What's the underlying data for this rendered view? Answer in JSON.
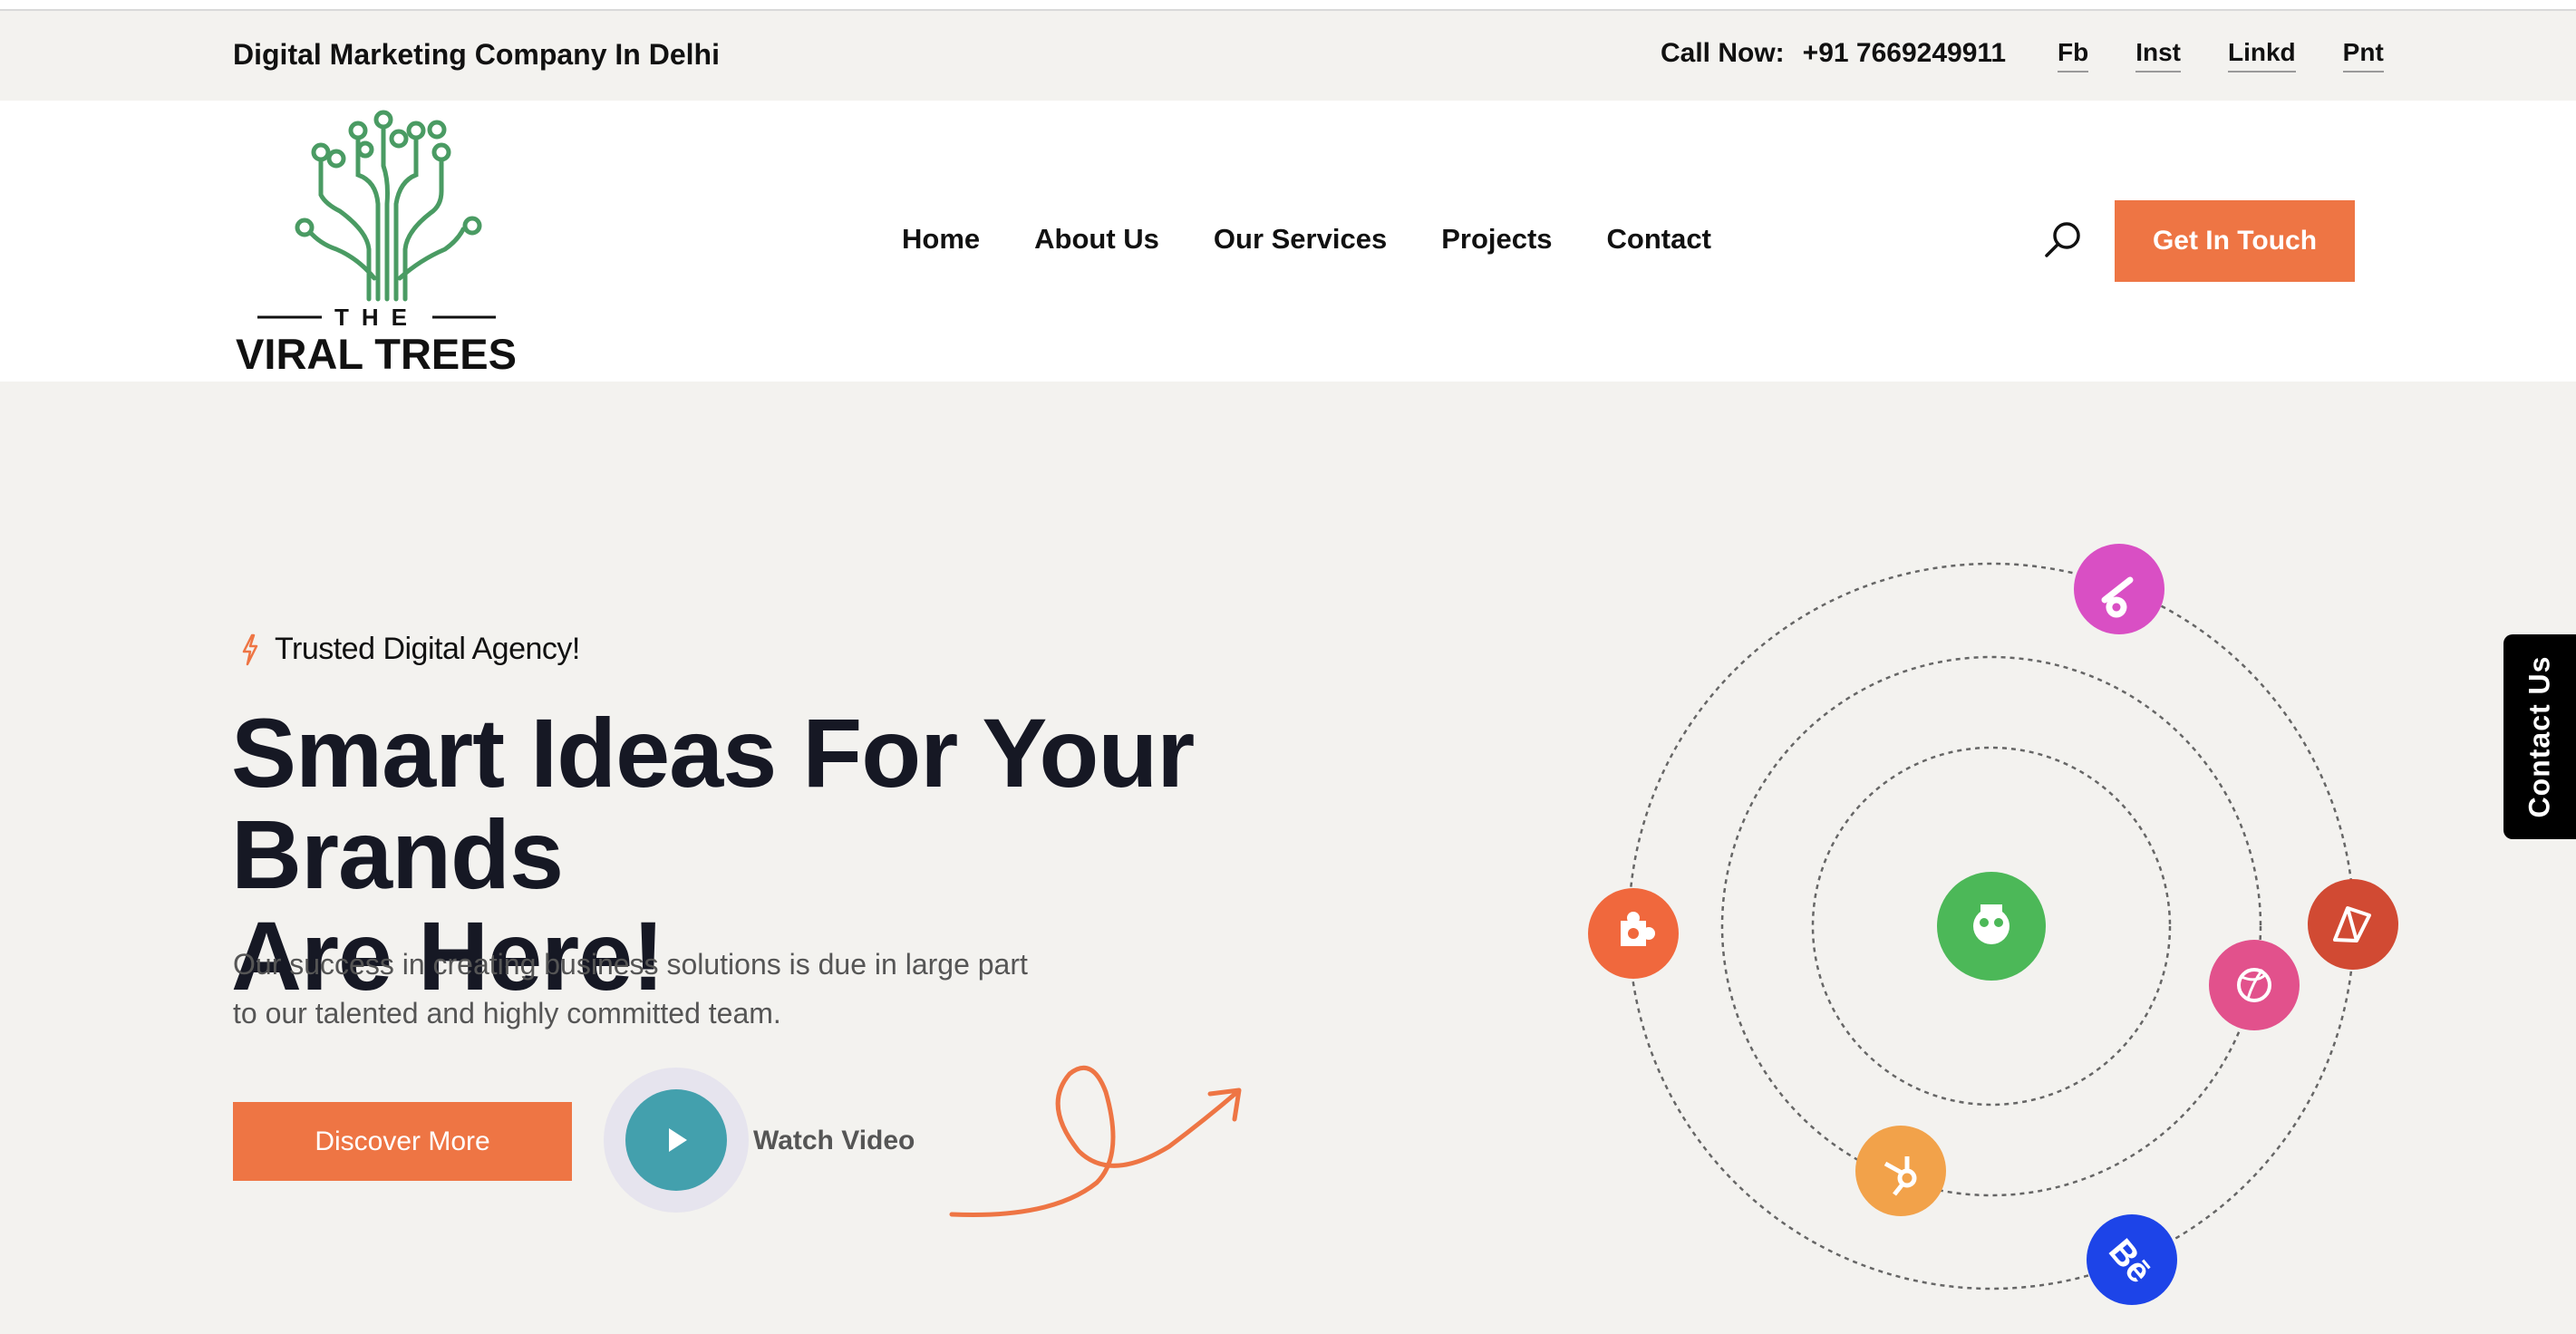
{
  "topbar": {
    "tagline": "Digital Marketing Company In Delhi",
    "call_label": "Call Now:",
    "phone": "+91 7669249911",
    "socials": [
      "Fb",
      "Inst",
      "Linkd",
      "Pnt"
    ]
  },
  "logo": {
    "text_small": "THE",
    "text_large": "VIRAL TREES",
    "color_tree": "#4a9b63"
  },
  "nav": {
    "items": [
      "Home",
      "About Us",
      "Our Services",
      "Projects",
      "Contact"
    ]
  },
  "header": {
    "search_icon": "search-icon",
    "cta_label": "Get In Touch"
  },
  "hero": {
    "badge": "Trusted Digital Agency!",
    "title_line1": "Smart Ideas For Your Brands",
    "title_line2": "Are Here!",
    "description": "Our success in creating business solutions is due in large part to our talented and highly committed team.",
    "discover_label": "Discover More",
    "watch_label": "Watch Video"
  },
  "side_tab": {
    "label": "Contact Us"
  },
  "colors": {
    "accent": "#ee7544",
    "play": "#43a0ad",
    "title": "#161824",
    "background": "#f3f2ef"
  }
}
